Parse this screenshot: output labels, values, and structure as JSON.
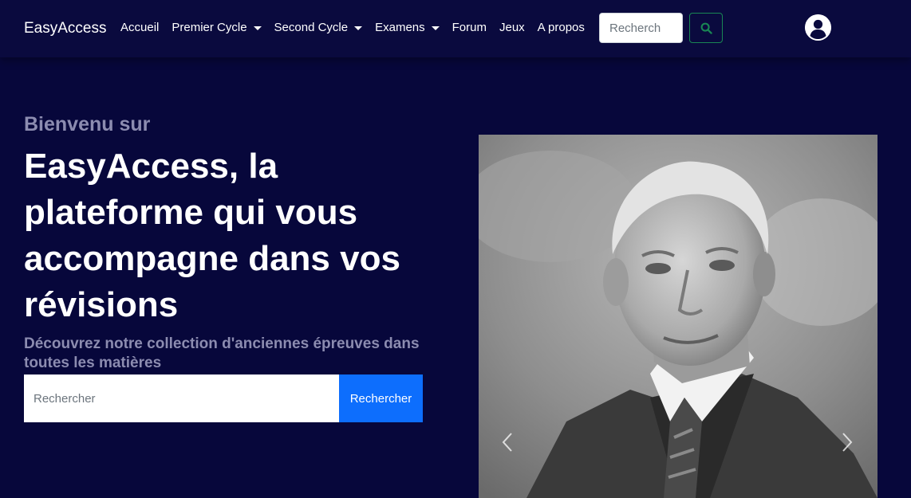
{
  "navbar": {
    "brand": "EasyAccess",
    "items": [
      {
        "label": "Accueil",
        "dropdown": false
      },
      {
        "label": "Premier Cycle",
        "dropdown": true
      },
      {
        "label": "Second Cycle",
        "dropdown": true
      },
      {
        "label": "Examens",
        "dropdown": true
      },
      {
        "label": "Forum",
        "dropdown": false
      },
      {
        "label": "Jeux",
        "dropdown": false
      },
      {
        "label": "A propos",
        "dropdown": false
      }
    ],
    "search_placeholder": "Recherch",
    "search_icon": "search-icon",
    "avatar_icon": "user-circle-icon"
  },
  "hero": {
    "welcome": "Bienvenu sur",
    "headline": "EasyAccess, la plateforme qui vous accompagne dans vos révisions",
    "subtitle": "Découvrez notre collection d'anciennes épreuves dans toutes les matières",
    "search_placeholder": "Rechercher",
    "search_button": "Rechercher"
  },
  "carousel": {
    "prev_icon": "chevron-left-icon",
    "next_icon": "chevron-right-icon"
  },
  "colors": {
    "background": "#07073b",
    "navbar": "#0a0a3e",
    "muted_text": "#8c8cb0",
    "primary": "#0d6efd",
    "success": "#198754"
  }
}
